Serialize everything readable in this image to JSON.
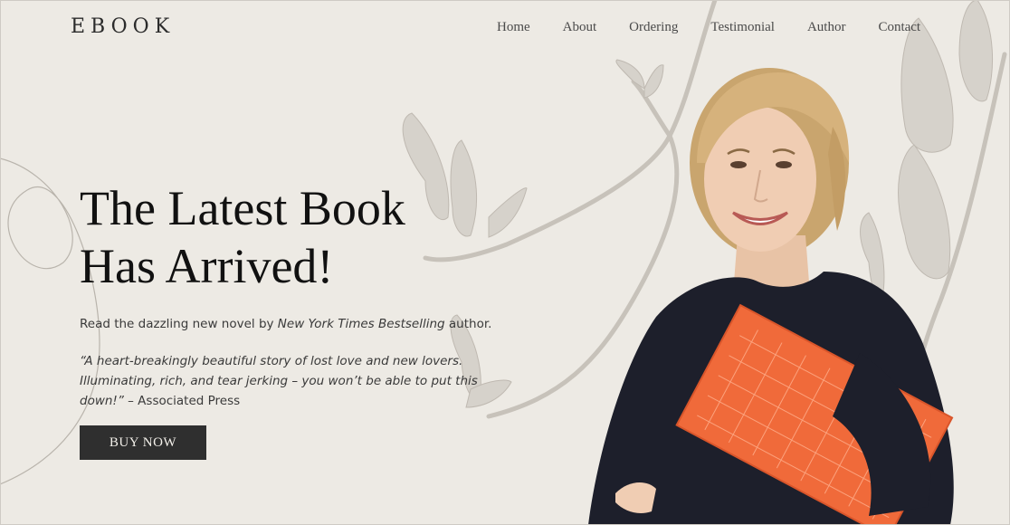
{
  "header": {
    "logo": "EBOOK",
    "nav": [
      "Home",
      "About",
      "Ordering",
      "Testimonial",
      "Author",
      "Contact"
    ]
  },
  "hero": {
    "title_line1": "The Latest Book",
    "title_line2": "Has Arrived!",
    "intro_prefix": "Read the dazzling new novel by ",
    "intro_emphasis": "New York Times Bestselling",
    "intro_suffix": " author.",
    "quote_text": "“A heart-breakingly beautiful story of lost love and new lovers. Illuminating, rich, and tear jerking – you won’t be able to put this down!”",
    "quote_source": " – Associated Press",
    "cta_label": "BUY NOW"
  },
  "colors": {
    "background": "#edeae4",
    "button": "#2f2f2f",
    "book": "#f06a3a",
    "sweater": "#1d1f2b"
  }
}
